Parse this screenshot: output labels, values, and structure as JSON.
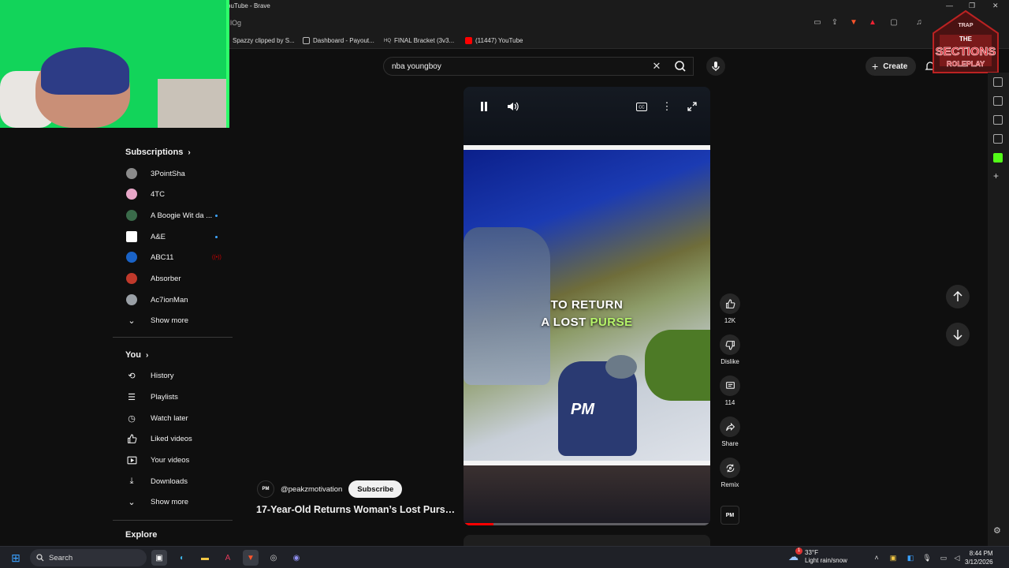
{
  "window": {
    "title": "ouTube - Brave",
    "url_fragment": "lOg"
  },
  "bookmarks": [
    {
      "label": "Spazzy clipped by S...",
      "icon": "bookmark-icon"
    },
    {
      "label": "Dashboard - Payout...",
      "icon": "dashboard-icon"
    },
    {
      "label": "FINAL Bracket (3v3...",
      "icon": "hq-icon"
    },
    {
      "label": "(11447) YouTube",
      "icon": "youtube-icon"
    }
  ],
  "search": {
    "value": "nba youngboy"
  },
  "header": {
    "create_label": "Create"
  },
  "sidebar": {
    "subscriptions_label": "Subscriptions",
    "subscriptions": [
      {
        "label": "3PointSha",
        "color": "#8b8b8b",
        "badge": "none"
      },
      {
        "label": "4TC",
        "color": "#e8a7c8",
        "badge": "none"
      },
      {
        "label": "A Boogie Wit da ...",
        "color": "#3a6b4a",
        "badge": "dot"
      },
      {
        "label": "A&E",
        "color": "#ffffff",
        "badge": "dot"
      },
      {
        "label": "ABC11",
        "color": "#1a63c7",
        "badge": "live"
      },
      {
        "label": "Absorber",
        "color": "#c0392b",
        "badge": "none"
      },
      {
        "label": "Ac7ionMan",
        "color": "#9aa0a6",
        "badge": "none"
      }
    ],
    "show_more_1": "Show more",
    "you_label": "You",
    "you_items": [
      {
        "label": "History",
        "icon": "history-icon",
        "glyph": "⟲"
      },
      {
        "label": "Playlists",
        "icon": "playlists-icon",
        "glyph": "☰"
      },
      {
        "label": "Watch later",
        "icon": "clock-icon",
        "glyph": "◷"
      },
      {
        "label": "Liked videos",
        "icon": "thumb-up-icon",
        "glyph": "👍"
      },
      {
        "label": "Your videos",
        "icon": "your-videos-icon",
        "glyph": "▶"
      },
      {
        "label": "Downloads",
        "icon": "download-icon",
        "glyph": "↓"
      }
    ],
    "show_more_2": "Show more",
    "explore_label": "Explore"
  },
  "video": {
    "caption_line1": "TO RETURN",
    "caption_line2_a": "A LOST ",
    "caption_line2_b": "PURSE",
    "watermark": "PM",
    "channel_avatar": "PM",
    "channel_handle": "@peakzmotivation",
    "subscribe_label": "Subscribe",
    "title": "17-Year-Old Returns Woman’s Lost Pursе...",
    "progress": 0.12
  },
  "actions": {
    "like_count": "12K",
    "dislike_label": "Dislike",
    "comment_count": "114",
    "share_label": "Share",
    "remix_label": "Remix",
    "channel_thumb": "PM"
  },
  "logo": {
    "line1": "TRAP",
    "line2": "THE",
    "line3": "SECTIONS",
    "line4": "ROLEPLAY"
  },
  "taskbar": {
    "search_label": "Search",
    "weather_temp": "33°F",
    "weather_desc": "Light rain/snow",
    "weather_badge": "1",
    "time": "8:44 PM",
    "date": "3/12/2026"
  },
  "colors": {
    "accent_red": "#ff0000",
    "caption_highlight": "#b6f56a",
    "webcam_green": "#12d45a"
  }
}
